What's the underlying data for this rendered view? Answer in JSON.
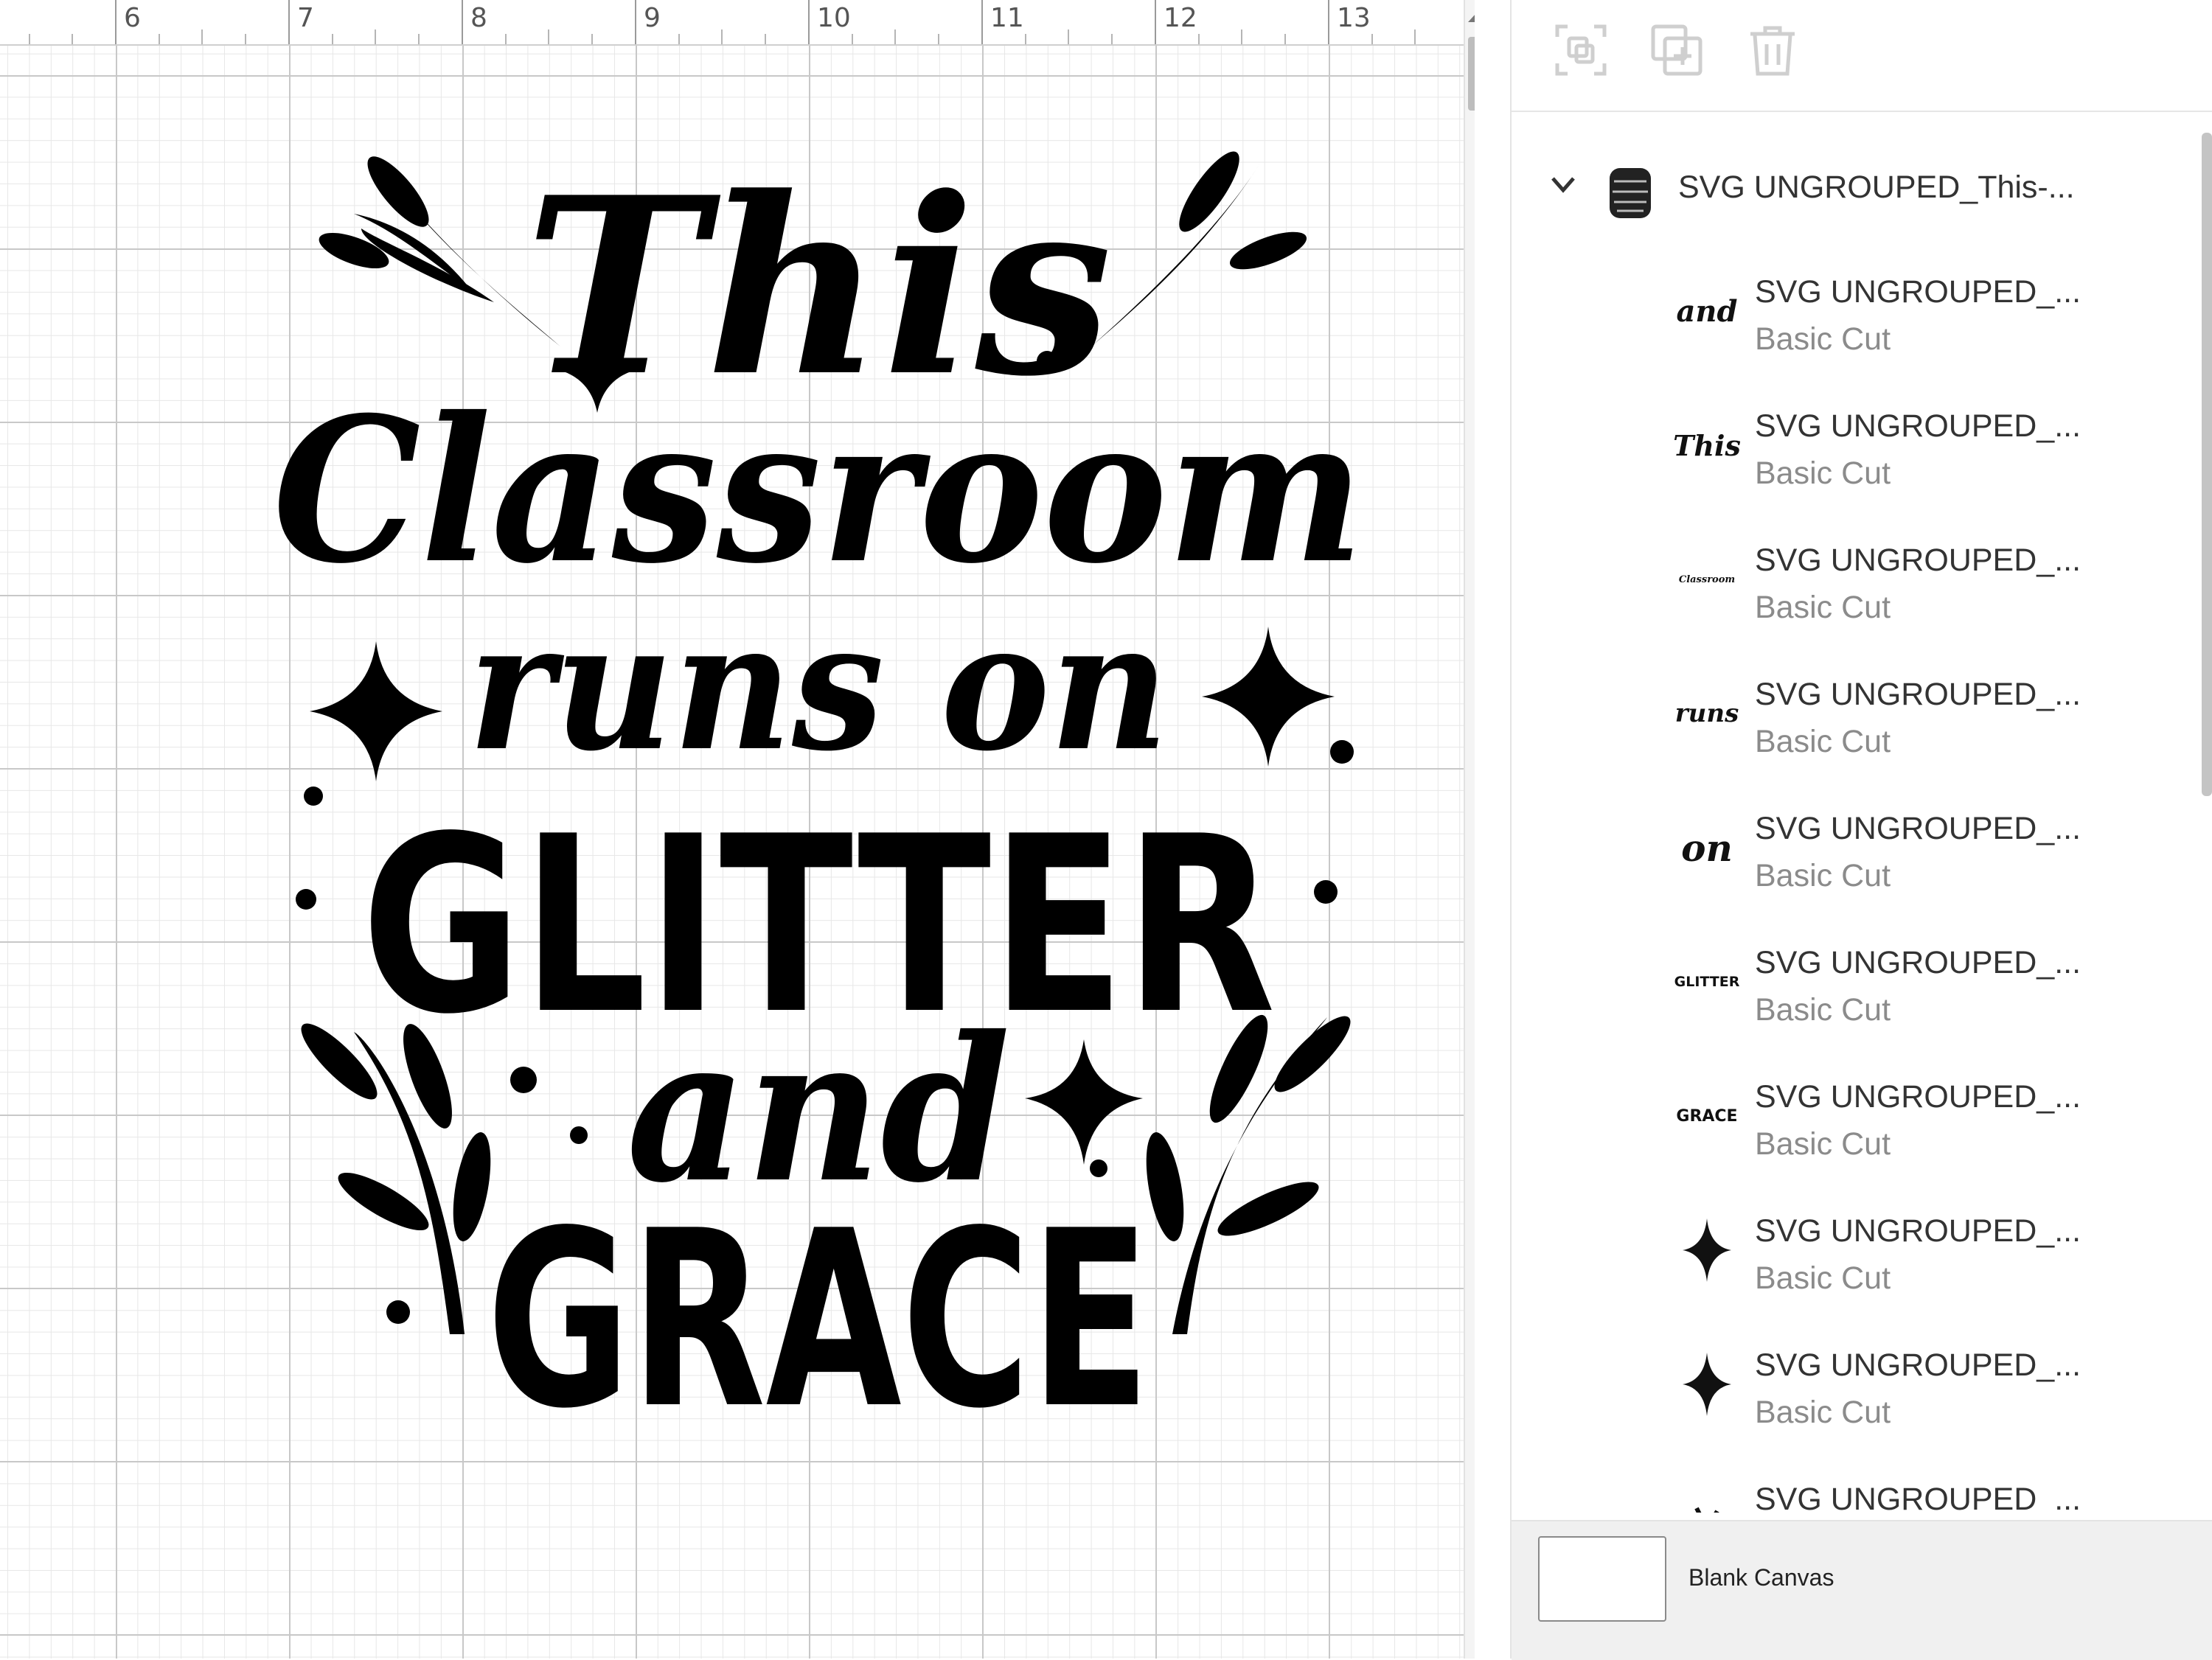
{
  "ruler": {
    "ticks": [
      "6",
      "7",
      "8",
      "9",
      "10",
      "11",
      "12",
      "13"
    ]
  },
  "design": {
    "words": [
      "This",
      "Classroom",
      "runs on",
      "GLITTER",
      "and",
      "GRACE"
    ]
  },
  "toolbar": {
    "icons": [
      "group-icon",
      "duplicate-icon",
      "delete-icon"
    ]
  },
  "layers": {
    "group": {
      "name": "SVG UNGROUPED_This-..."
    },
    "items": [
      {
        "name": "SVG UNGROUPED_...",
        "type": "Basic Cut",
        "thumb": "and"
      },
      {
        "name": "SVG UNGROUPED_...",
        "type": "Basic Cut",
        "thumb": "This"
      },
      {
        "name": "SVG UNGROUPED_...",
        "type": "Basic Cut",
        "thumb": "Classroom"
      },
      {
        "name": "SVG UNGROUPED_...",
        "type": "Basic Cut",
        "thumb": "runs"
      },
      {
        "name": "SVG UNGROUPED_...",
        "type": "Basic Cut",
        "thumb": "on"
      },
      {
        "name": "SVG UNGROUPED_...",
        "type": "Basic Cut",
        "thumb": "GLITTER"
      },
      {
        "name": "SVG UNGROUPED_...",
        "type": "Basic Cut",
        "thumb": "GRACE"
      },
      {
        "name": "SVG UNGROUPED_...",
        "type": "Basic Cut",
        "thumb": "sparkle"
      },
      {
        "name": "SVG UNGROUPED_...",
        "type": "Basic Cut",
        "thumb": "sparkle"
      },
      {
        "name": "SVG UNGROUPED_...",
        "type": "",
        "thumb": "branch"
      }
    ]
  },
  "blank_canvas": {
    "label": "Blank Canvas"
  },
  "colors": {
    "ink": "#000000",
    "grid_major": "#c8c8c8",
    "grid_minor": "#e7e7e7",
    "muted_text": "#8b8b8b"
  }
}
